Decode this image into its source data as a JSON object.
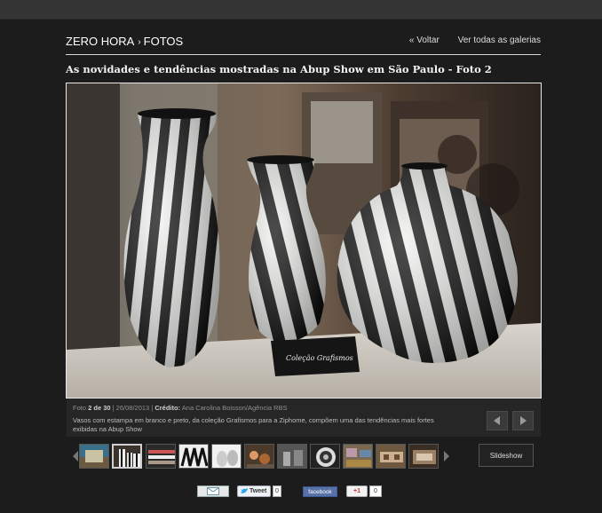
{
  "header": {
    "brand": "ZERO HORA",
    "section": "FOTOS",
    "back_label": "« Voltar",
    "all_galleries_label": "Ver todas as galerias"
  },
  "gallery": {
    "title": "As novidades e tendências mostradas na Abup Show em São Paulo - Foto 2",
    "photo_sign_text": "Coleção Grafismos"
  },
  "caption": {
    "photo_prefix": "Foto",
    "photo_position": "2 de 30",
    "date": "| 26/08/2013 |",
    "credit_label": "Crédito:",
    "credit_value": "Ana Carolina Boisson/Agência RBS",
    "description": "Vasos com estampa em branco e preto, da coleção Grafismos para a Ziphome, compõem uma das tendências mais fortes exibidas na Abup Show"
  },
  "controls": {
    "slideshow_label": "Slideshow"
  },
  "social": {
    "tweet_label": "Tweet",
    "tweet_count": "0",
    "facebook_label": "facebook",
    "gplus_label": "+1",
    "gplus_count": "0"
  },
  "thumbnails": {
    "count": 11,
    "active_index": 1
  }
}
